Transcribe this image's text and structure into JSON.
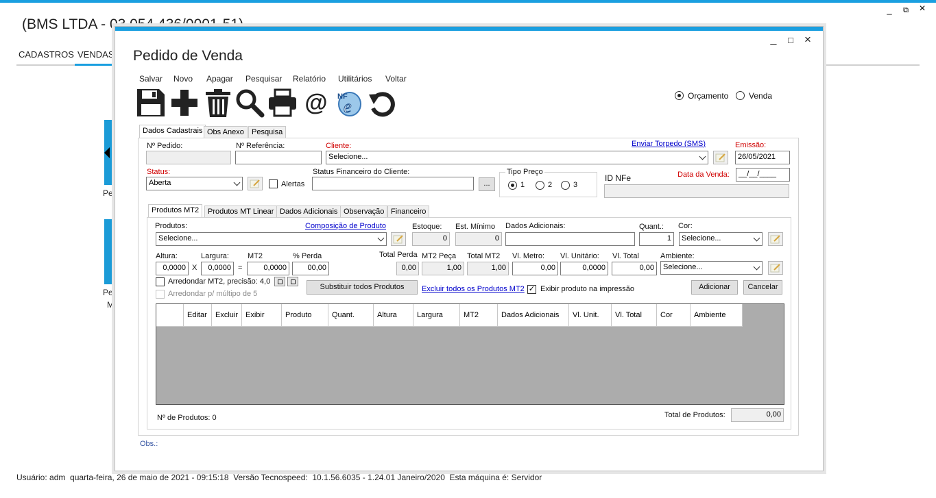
{
  "app": {
    "title": "(BMS LTDA - 03.054.436/0001-51)",
    "window_controls": {
      "minimize": "_",
      "restore": "⧉",
      "close": "×"
    },
    "menu": [
      "CADASTROS",
      "VENDAS"
    ],
    "tiles": {
      "tile1_label": "Pec",
      "tile2_label1": "Pec",
      "tile2_label2": "M"
    }
  },
  "statusbar": "Usuário: adm  quarta-feira, 26 de maio de 2021 - 09:15:18  Versão Tecnospeed:  10.1.56.6035 - 1.24.01 Janeiro/2020  Esta máquina é: Servidor",
  "dialog": {
    "title": "Pedido de Venda",
    "controls": {
      "minimize": "_",
      "maximize": "□",
      "close": "×"
    },
    "menu": {
      "salvar": "Salvar",
      "novo": "Novo",
      "apagar": "Apagar",
      "pesquisar": "Pesquisar",
      "relatorio": "Relatório",
      "utilitarios": "Utilitários",
      "voltar": "Voltar"
    },
    "toolbar_icons": [
      "save-icon",
      "add-icon",
      "trash-icon",
      "search-icon",
      "print-icon",
      "email-icon",
      "nfe-icon",
      "undo-icon"
    ],
    "tipo": {
      "orcamento": "Orçamento",
      "venda": "Venda",
      "selected": "Orçamento"
    },
    "tabs": {
      "dados": "Dados Cadastrais",
      "obs": "Obs Anexo",
      "pesquisa": "Pesquisa"
    },
    "form": {
      "pedido_label": "Nº Pedido:",
      "pedido_value": "",
      "referencia_label": "Nº Referência:",
      "referencia_value": "",
      "cliente_label": "Cliente:",
      "cliente_value": "Selecione...",
      "sms_link": "Enviar Torpedo (SMS)",
      "emissao_label": "Emissão:",
      "emissao_value": "26/05/2021",
      "status_label": "Status:",
      "status_value": "Aberta",
      "alertas_label": "Alertas",
      "status_fin_label": "Status Financeiro do Cliente:",
      "status_fin_value": "",
      "ellipsis": "...",
      "tipo_preco_label": "Tipo Preço",
      "tipo_preco_options": [
        "1",
        "2",
        "3"
      ],
      "tipo_preco_selected": "1",
      "id_nfe_label": "ID NFe",
      "id_nfe_value": "",
      "data_venda_label": "Data da Venda:",
      "data_venda_value": "__/__/____"
    },
    "sub_tabs": {
      "mt2": "Produtos MT2",
      "linear": "Produtos MT Linear",
      "adicionais": "Dados Adicionais",
      "observacao": "Observação",
      "financeiro": "Financeiro"
    },
    "produtos": {
      "produtos_label": "Produtos:",
      "produtos_value": "Selecione...",
      "composicao_link": "Composição de Produto",
      "estoque_label": "Estoque:",
      "estoque_value": "0",
      "est_min_label": "Est. Mínimo",
      "est_min_value": "0",
      "dados_adic_label": "Dados Adicionais:",
      "dados_adic_value": "",
      "quant_label": "Quant.:",
      "quant_value": "1",
      "cor_label": "Cor:",
      "cor_value": "Selecione...",
      "altura_label": "Altura:",
      "altura_value": "0,0000",
      "times": "X",
      "largura_label": "Largura:",
      "largura_value": "0,0000",
      "equals": "=",
      "mt2_label": "MT2",
      "mt2_value": "0,0000",
      "perda_label": "% Perda",
      "perda_value": "00,00",
      "total_perda_label": "Total Perda",
      "total_perda_value": "0,00",
      "mt2_peca_label": "MT2 Peça",
      "mt2_peca_value": "1,00",
      "total_mt2_label": "Total MT2",
      "total_mt2_value": "1,00",
      "vl_metro_label": "Vl. Metro:",
      "vl_metro_value": "0,00",
      "vl_unit_label": "Vl. Unitário:",
      "vl_unit_value": "0,0000",
      "vl_total_label": "Vl. Total",
      "vl_total_value": "0,00",
      "ambiente_label": "Ambiente:",
      "ambiente_value": "Selecione...",
      "arredondar_label": "Arredondar MT2, precisão: 4,0",
      "arredondar_mult_label": "Arredondar p/ múltipo de 5",
      "substituir_btn": "Substituir todos Produtos",
      "excluir_link": "Excluir todos os Produtos MT2",
      "exibir_label": "Exibir produto na impressão",
      "adicionar_btn": "Adicionar",
      "cancelar_btn": "Cancelar"
    },
    "grid_columns": [
      "",
      "Editar",
      "Excluir",
      "Exibir",
      "Produto",
      "Quant.",
      "Altura",
      "Largura",
      "MT2",
      "Dados Adicionais",
      "Vl. Unit.",
      "Vl. Total",
      "Cor",
      "Ambiente"
    ],
    "footer": {
      "n_produtos": "Nº de Produtos: 0",
      "total_label": "Total de Produtos:",
      "total_value": "0,00",
      "obs_label": "Obs.:"
    }
  },
  "colors": {
    "accent": "#1a9fe0",
    "required": "#d00000",
    "link": "#0000cc",
    "grid_bg": "#acacac"
  }
}
